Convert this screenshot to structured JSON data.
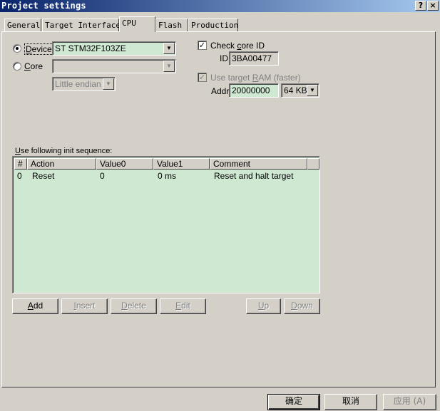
{
  "window": {
    "title": "Project settings",
    "help_glyph": "?",
    "close_glyph": "×"
  },
  "tabs": [
    {
      "label": "General"
    },
    {
      "label": "Target Interface"
    },
    {
      "label": "CPU"
    },
    {
      "label": "Flash"
    },
    {
      "label": "Production"
    }
  ],
  "cpu": {
    "device": {
      "label_first": "D",
      "label_rest": "evice",
      "value": "ST STM32F103ZE",
      "selected": true
    },
    "core": {
      "label_first": "C",
      "label_rest": "ore",
      "value": "",
      "selected": false
    },
    "endian": {
      "value": "Little endian"
    },
    "check_core_id": {
      "label_pre": "Check ",
      "label_u": "c",
      "label_post": "ore ID",
      "checked": true,
      "check_glyph": "✓"
    },
    "id": {
      "label": "ID",
      "value": "3BA00477"
    },
    "use_target_ram": {
      "label_pre": "Use target ",
      "label_u": "R",
      "label_post": "AM (faster)",
      "checked": true,
      "check_glyph": "✓"
    },
    "addr": {
      "label": "Addr",
      "value": "20000000"
    },
    "ram_size": {
      "value": "64 KB"
    },
    "dropdown_glyph": "▼"
  },
  "init_sequence": {
    "label_u": "U",
    "label_rest": "se following init sequence:",
    "columns": [
      "#",
      "Action",
      "Value0",
      "Value1",
      "Comment"
    ],
    "rows": [
      {
        "num": "0",
        "action": "Reset",
        "value0": "0",
        "value1": "0 ms",
        "comment": "Reset and halt target"
      }
    ]
  },
  "list_buttons": {
    "add": {
      "u": "A",
      "rest": "dd"
    },
    "insert": {
      "u": "I",
      "rest": "nsert"
    },
    "delete": {
      "u": "D",
      "rest": "elete"
    },
    "edit": {
      "u": "E",
      "rest": "dit"
    },
    "up": {
      "u": "U",
      "rest": "p"
    },
    "down": {
      "u": "D",
      "rest": "own"
    }
  },
  "footer": {
    "ok": "确定",
    "cancel": "取消",
    "apply": "应用 (A)"
  }
}
